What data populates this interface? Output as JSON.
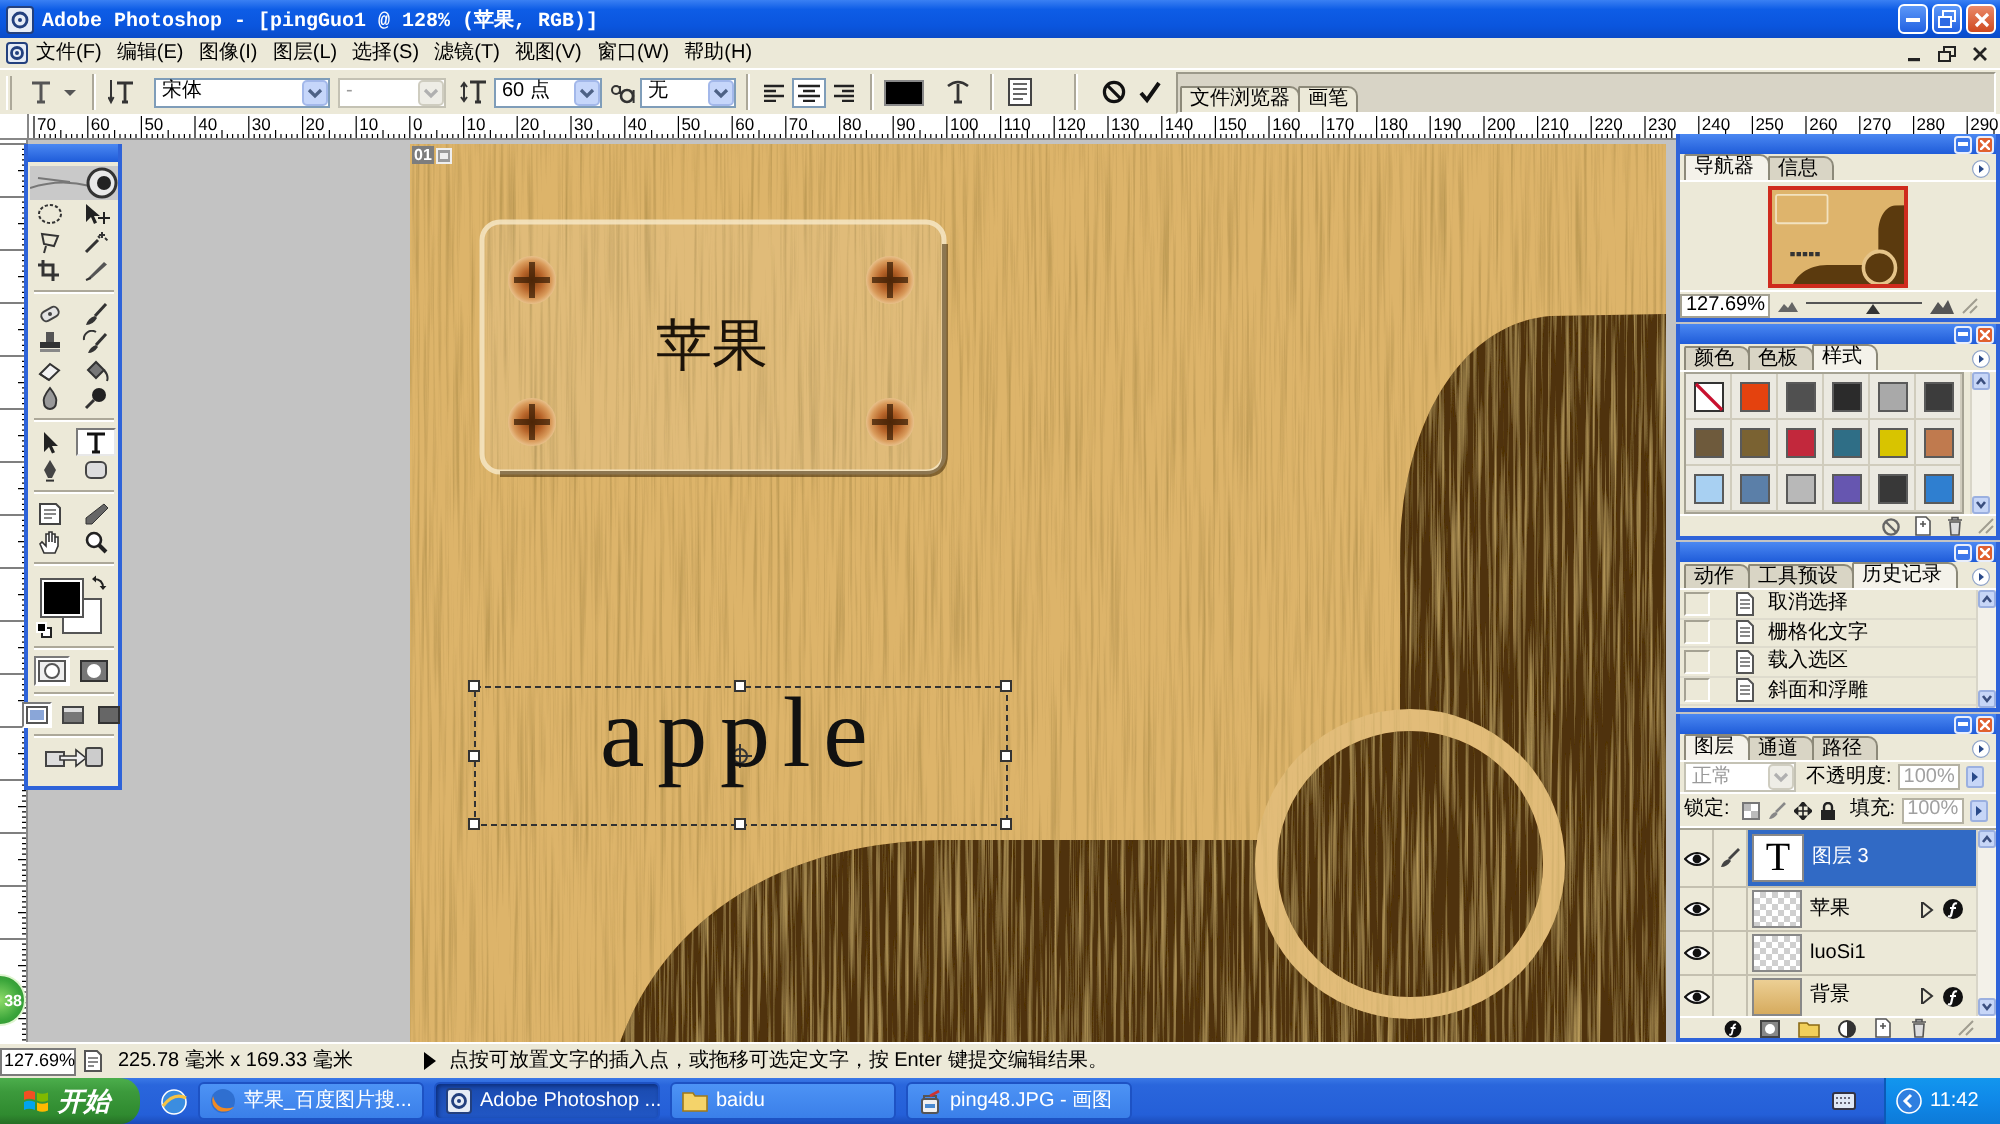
{
  "window": {
    "title": "Adobe Photoshop - [pingGuo1 @ 128% (苹果, RGB)]"
  },
  "menu": [
    "文件(F)",
    "编辑(E)",
    "图像(I)",
    "图层(L)",
    "选择(S)",
    "滤镜(T)",
    "视图(V)",
    "窗口(W)",
    "帮助(H)"
  ],
  "options_bar": {
    "font_family": "宋体",
    "font_style": "-",
    "font_style_disabled": true,
    "font_size": "60 点",
    "antialiasing": "无",
    "alignment": [
      {
        "kind": "left",
        "selected": false
      },
      {
        "kind": "center",
        "selected": true
      },
      {
        "kind": "right",
        "selected": false
      }
    ],
    "palette_well": [
      "文件浏览器",
      "画笔"
    ]
  },
  "rulers": {
    "horizontal": [
      "70",
      "60",
      "50",
      "40",
      "30",
      "20",
      "10",
      "0",
      "10",
      "20",
      "30",
      "40",
      "50",
      "60",
      "70",
      "80",
      "90",
      "100",
      "110",
      "120",
      "130",
      "140",
      "150",
      "160",
      "170",
      "180",
      "190",
      "200",
      "210",
      "220",
      "230",
      "240",
      "250",
      "260",
      "270",
      "280",
      "290"
    ]
  },
  "toolbox": {
    "tools": [
      {
        "kind": "marquee",
        "selected": false
      },
      {
        "kind": "move",
        "selected": false
      },
      {
        "kind": "lasso",
        "selected": false
      },
      {
        "kind": "magic-wand",
        "selected": false
      },
      {
        "kind": "crop",
        "selected": false
      },
      {
        "kind": "slice",
        "selected": false
      },
      {
        "kind": "healing-brush",
        "selected": false
      },
      {
        "kind": "brush",
        "selected": false
      },
      {
        "kind": "clone-stamp",
        "selected": false
      },
      {
        "kind": "history-brush",
        "selected": false
      },
      {
        "kind": "eraser",
        "selected": false
      },
      {
        "kind": "paint-bucket",
        "selected": false
      },
      {
        "kind": "blur",
        "selected": false
      },
      {
        "kind": "dodge",
        "selected": false
      },
      {
        "kind": "path-select",
        "selected": false
      },
      {
        "kind": "type",
        "selected": true
      },
      {
        "kind": "pen",
        "selected": false
      },
      {
        "kind": "shape",
        "selected": false
      },
      {
        "kind": "notes",
        "selected": false
      },
      {
        "kind": "eyedropper",
        "selected": false
      },
      {
        "kind": "hand",
        "selected": false
      },
      {
        "kind": "zoom",
        "selected": false
      }
    ],
    "mask_modes": [
      {
        "kind": "standard",
        "selected": true
      },
      {
        "kind": "quick-mask",
        "selected": false
      }
    ],
    "screen_modes": [
      {
        "selected": true
      },
      {
        "selected": false
      },
      {
        "selected": false
      }
    ]
  },
  "document": {
    "slice_number": "01",
    "sign_text": "苹果",
    "type_text": "apple",
    "text_box_active": true
  },
  "navigator": {
    "tabs": [
      {
        "label": "导航器",
        "selected": true
      },
      {
        "label": "信息",
        "selected": false
      }
    ],
    "zoom": "127.69%",
    "zoom_slider": {
      "level": 0.57
    }
  },
  "styles_palette": {
    "tabs": [
      {
        "label": "颜色",
        "selected": false
      },
      {
        "label": "色板",
        "selected": false
      },
      {
        "label": "样式",
        "selected": true
      }
    ],
    "styles": [
      {
        "kind": "none"
      },
      {
        "kind": "color",
        "color": "#e4420e"
      },
      {
        "kind": "color",
        "color": "#505050"
      },
      {
        "kind": "color",
        "color": "#2b2b2b"
      },
      {
        "kind": "color",
        "color": "#a9a9a9"
      },
      {
        "kind": "color",
        "color": "#3c3c3c"
      },
      {
        "kind": "color",
        "color": "#6e5a3c"
      },
      {
        "kind": "color",
        "color": "#7a6232"
      },
      {
        "kind": "color",
        "color": "#c2283c"
      },
      {
        "kind": "color",
        "color": "#2f6e86"
      },
      {
        "kind": "color",
        "color": "#d8c400"
      },
      {
        "kind": "color",
        "color": "#c07a4e"
      },
      {
        "kind": "color",
        "color": "#a8d0f2"
      },
      {
        "kind": "color",
        "color": "#5b7fa8"
      },
      {
        "kind": "color",
        "color": "#b8b8b8"
      },
      {
        "kind": "color",
        "color": "#6656b0"
      },
      {
        "kind": "color",
        "color": "#383838"
      },
      {
        "kind": "color",
        "color": "#2f7fd0"
      }
    ]
  },
  "history_palette": {
    "tabs": [
      {
        "label": "动作",
        "selected": false
      },
      {
        "label": "工具预设",
        "selected": false
      },
      {
        "label": "历史记录",
        "selected": true
      }
    ],
    "states": [
      "取消选择",
      "栅格化文字",
      "载入选区",
      "斜面和浮雕"
    ]
  },
  "layers_palette": {
    "tabs": [
      {
        "label": "图层",
        "selected": true
      },
      {
        "label": "通道",
        "selected": false
      },
      {
        "label": "路径",
        "selected": false
      }
    ],
    "blend_mode": "正常",
    "opacity_label": "不透明度:",
    "opacity": "100%",
    "lock_label": "锁定:",
    "fill_label": "填充:",
    "fill": "100%",
    "options_disabled": true,
    "layers": [
      {
        "name": "图层 3",
        "kind": "text",
        "thumb_text": "T",
        "visible": true,
        "selected": true,
        "has_effects": false
      },
      {
        "name": "苹果",
        "kind": "raster",
        "visible": true,
        "selected": false,
        "has_effects": true,
        "effects_expanded": false
      },
      {
        "name": "luoSi1",
        "kind": "raster",
        "visible": true,
        "selected": false,
        "has_effects": false
      },
      {
        "name": "背景",
        "kind": "image",
        "visible": true,
        "selected": false,
        "has_effects": true,
        "effects_expanded": false
      }
    ]
  },
  "status_bar": {
    "zoom": "127.69%",
    "document_size": "225.78 毫米 x 169.33 毫米",
    "hint": "点按可放置文字的插入点，或拖移可选定文字，按 Enter 键提交编辑结果。"
  },
  "taskbar": {
    "start": "开始",
    "tasks": [
      {
        "kind": "browser",
        "label": "苹果_百度图片搜...",
        "selected": false
      },
      {
        "kind": "photoshop",
        "label": "Adobe Photoshop ...",
        "selected": true
      },
      {
        "kind": "folder",
        "label": "baidu",
        "selected": false
      },
      {
        "kind": "paint",
        "label": "ping48.JPG - 画图",
        "selected": false
      }
    ],
    "clock": "11:42"
  },
  "desktop_widget": {
    "value": "38"
  }
}
